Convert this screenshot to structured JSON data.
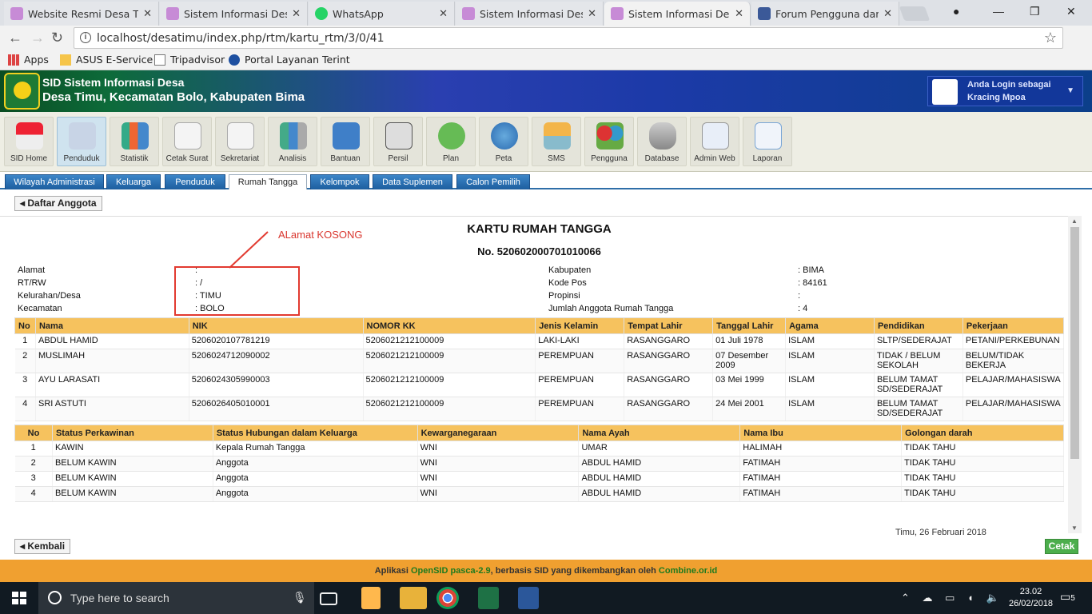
{
  "browser": {
    "tabs": [
      {
        "title": "Website Resmi Desa Tim",
        "active": false
      },
      {
        "title": "Sistem Informasi Desa",
        "active": false
      },
      {
        "title": "WhatsApp",
        "active": false
      },
      {
        "title": "Sistem Informasi Desa",
        "active": false
      },
      {
        "title": "Sistem Informasi Desa",
        "active": true
      },
      {
        "title": "Forum Pengguna dan P",
        "active": false
      }
    ],
    "url": "localhost/desatimu/index.php/rtm/kartu_rtm/3/0/41",
    "bookmarks": [
      "Apps",
      "ASUS E-Service",
      "Tripadvisor",
      "Portal Layanan Terint"
    ]
  },
  "header": {
    "app_title": "SID Sistem Informasi Desa",
    "location": "Desa Timu, Kecamatan Bolo, Kabupaten Bima",
    "user_line1": "Anda Login sebagai",
    "user_line2": "Kracing Mpoa"
  },
  "modules": [
    "SID Home",
    "Penduduk",
    "Statistik",
    "Cetak Surat",
    "Sekretariat",
    "Analisis",
    "Bantuan",
    "Persil",
    "Plan",
    "Peta",
    "SMS",
    "Pengguna",
    "Database",
    "Admin Web",
    "Laporan"
  ],
  "subtabs": [
    "Wilayah Administrasi",
    "Keluarga",
    "Penduduk",
    "Rumah Tangga",
    "Kelompok",
    "Data Suplemen",
    "Calon Pemilih"
  ],
  "buttons": {
    "daftar": "Daftar Anggota",
    "kembali": "Kembali",
    "cetak": "Cetak"
  },
  "document": {
    "title": "KARTU RUMAH TANGGA",
    "number": "No. 520602000701010066",
    "annotation": "ALamat KOSONG",
    "left_fields": [
      {
        "label": "Alamat",
        "value": ":"
      },
      {
        "label": "RT/RW",
        "value": ": /"
      },
      {
        "label": "Kelurahan/Desa",
        "value": ": TIMU"
      },
      {
        "label": "Kecamatan",
        "value": ": BOLO"
      }
    ],
    "right_fields": [
      {
        "label": "Kabupaten",
        "value": ": BIMA"
      },
      {
        "label": "Kode Pos",
        "value": ": 84161"
      },
      {
        "label": "Propinsi",
        "value": ":"
      },
      {
        "label": "Jumlah Anggota Rumah Tangga",
        "value": ": 4"
      }
    ],
    "table1": {
      "headers": [
        "No",
        "Nama",
        "NIK",
        "NOMOR KK",
        "Jenis Kelamin",
        "Tempat Lahir",
        "Tanggal Lahir",
        "Agama",
        "Pendidikan",
        "Pekerjaan"
      ],
      "rows": [
        [
          "1",
          "ABDUL HAMID",
          "5206020107781219",
          "5206021212100009",
          "LAKI-LAKI",
          "RASANGGARO",
          "01 Juli 1978",
          "ISLAM",
          "SLTP/SEDERAJAT",
          "PETANI/PERKEBUNAN"
        ],
        [
          "2",
          "MUSLIMAH",
          "5206024712090002",
          "5206021212100009",
          "PEREMPUAN",
          "RASANGGARO",
          "07 Desember 2009",
          "ISLAM",
          "TIDAK / BELUM SEKOLAH",
          "BELUM/TIDAK BEKERJA"
        ],
        [
          "3",
          "AYU LARASATI",
          "5206024305990003",
          "5206021212100009",
          "PEREMPUAN",
          "RASANGGARO",
          "03 Mei 1999",
          "ISLAM",
          "BELUM TAMAT SD/SEDERAJAT",
          "PELAJAR/MAHASISWA"
        ],
        [
          "4",
          "SRI ASTUTI",
          "5206026405010001",
          "5206021212100009",
          "PEREMPUAN",
          "RASANGGARO",
          "24 Mei 2001",
          "ISLAM",
          "BELUM TAMAT SD/SEDERAJAT",
          "PELAJAR/MAHASISWA"
        ]
      ]
    },
    "table2": {
      "headers": [
        "No",
        "Status Perkawinan",
        "Status Hubungan dalam Keluarga",
        "Kewarganegaraan",
        "Nama Ayah",
        "Nama Ibu",
        "Golongan darah"
      ],
      "rows": [
        [
          "1",
          "KAWIN",
          "Kepala Rumah Tangga",
          "WNI",
          "UMAR",
          "HALIMAH",
          "TIDAK TAHU"
        ],
        [
          "2",
          "BELUM KAWIN",
          "Anggota",
          "WNI",
          "ABDUL HAMID",
          "FATIMAH",
          "TIDAK TAHU"
        ],
        [
          "3",
          "BELUM KAWIN",
          "Anggota",
          "WNI",
          "ABDUL HAMID",
          "FATIMAH",
          "TIDAK TAHU"
        ],
        [
          "4",
          "BELUM KAWIN",
          "Anggota",
          "WNI",
          "ABDUL HAMID",
          "FATIMAH",
          "TIDAK TAHU"
        ]
      ]
    },
    "signature_date": "Timu, 26 Februari 2018"
  },
  "footer": {
    "pre": "Aplikasi ",
    "app": "OpenSID pasca-2.9",
    "mid": ", berbasis SID yang dikembangkan oleh ",
    "org": "Combine.or.id"
  },
  "taskbar": {
    "search_placeholder": "Type here to search",
    "time": "23.02",
    "date": "26/02/2018",
    "notifications": "5"
  }
}
